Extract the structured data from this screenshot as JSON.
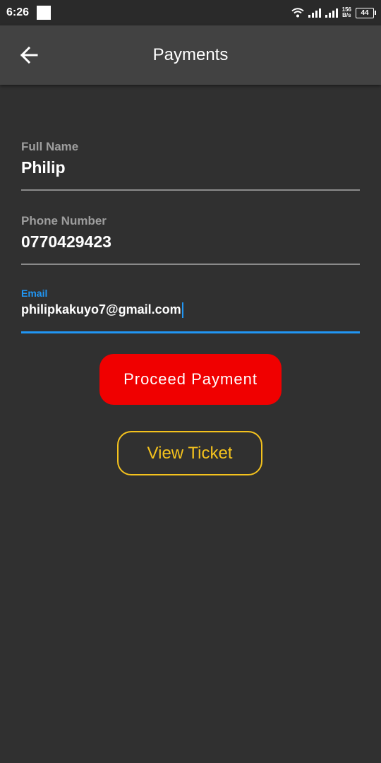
{
  "status_bar": {
    "time": "6:26",
    "net_speed_value": "156",
    "net_speed_unit": "B/s",
    "battery_level": "44"
  },
  "app_bar": {
    "title": "Payments",
    "back_icon": "arrow-left-icon"
  },
  "form": {
    "full_name": {
      "label": "Full Name",
      "value": "Philip"
    },
    "phone": {
      "label": "Phone Number",
      "value": "0770429423"
    },
    "email": {
      "label": "Email",
      "value": "philipkakuyo7@gmail.com"
    }
  },
  "actions": {
    "proceed_label": "Proceed Payment",
    "view_ticket_label": "View Ticket"
  },
  "colors": {
    "background": "#303030",
    "app_bar": "#424242",
    "accent_focus": "#2196f3",
    "proceed": "#f00000",
    "ticket": "#f4c21d"
  }
}
